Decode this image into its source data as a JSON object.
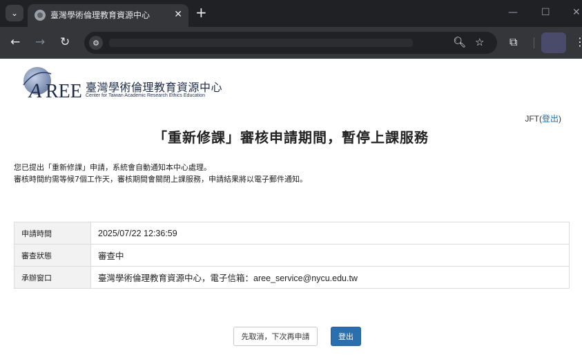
{
  "browser": {
    "tab_title": "臺灣學術倫理教育資源中心",
    "tab_close": "✕",
    "new_tab": "+",
    "menu_icon": "⌄",
    "window_minimize": "—",
    "window_maximize": "☐",
    "window_close": "✕"
  },
  "header": {
    "logo_letters": "AREE",
    "logo_cn": "臺灣學術倫理教育資源中心",
    "logo_en": "Center for Taiwan Academic Research Ethics Education",
    "user_name": "JFT",
    "logout_link": "登出"
  },
  "main": {
    "title": "「重新修課」審核申請期間，暫停上課服務",
    "message_line1": "您已提出「重新修課」申請，系統會自動通知本中心處理。",
    "message_line2": "審核時間約需等候7個工作天，審核期間會關閉上課服務，申請結果將以電子郵件通知。",
    "table": [
      {
        "label": "申請時間",
        "value": "2025/07/22 12:36:59"
      },
      {
        "label": "審查狀態",
        "value": "審查中"
      },
      {
        "label": "承辦窗口",
        "value": "臺灣學術倫理教育資源中心，電子信箱：aree_service@nycu.edu.tw"
      }
    ],
    "cancel_button": "先取消，下次再申請",
    "logout_button": "登出"
  },
  "colors": {
    "accent": "#2c6fae",
    "link": "#1a6fb0",
    "chrome_dark": "#202124",
    "chrome_bar": "#35363a"
  }
}
